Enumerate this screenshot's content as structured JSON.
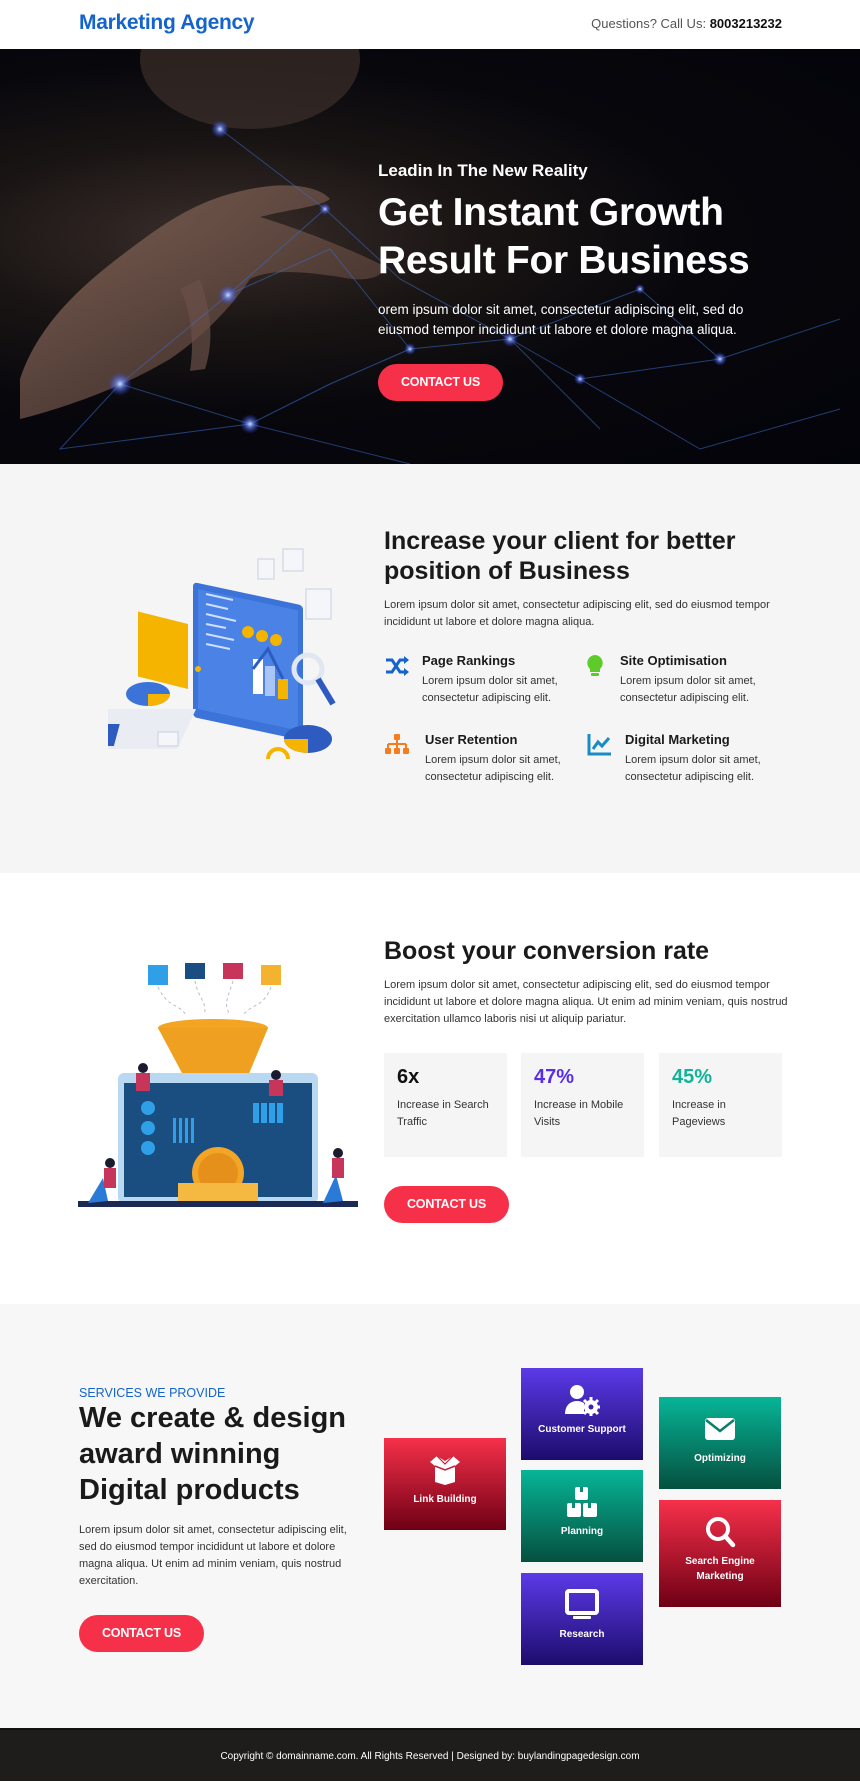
{
  "header": {
    "logo": "Marketing Agency",
    "call_label": "Questions? Call Us:",
    "phone": "8003213232"
  },
  "hero": {
    "subtitle": "Leadin In The New Reality",
    "title": "Get Instant Growth Result For Business",
    "text": "orem ipsum dolor sit amet, consectetur adipiscing elit, sed do eiusmod tempor incididunt ut labore et dolore magna aliqua.",
    "cta": "CONTACT US"
  },
  "features_section": {
    "title": "Increase your client for better position of Business",
    "lead": "Lorem ipsum dolor sit amet, consectetur adipiscing elit, sed do eiusmod tempor incididunt ut labore et dolore magna aliqua.",
    "items": [
      {
        "icon": "shuffle-icon",
        "title": "Page Rankings",
        "text": "Lorem ipsum dolor sit amet, consectetur adipiscing elit.",
        "color": "#1464cc"
      },
      {
        "icon": "lightbulb-icon",
        "title": "Site Optimisation",
        "text": "Lorem ipsum dolor sit amet, consectetur adipiscing elit.",
        "color": "#5ecb2a"
      },
      {
        "icon": "sitemap-icon",
        "title": "User Retention",
        "text": "Lorem ipsum dolor sit amet, consectetur adipiscing elit.",
        "color": "#f57c1f"
      },
      {
        "icon": "line-chart-icon",
        "title": "Digital Marketing",
        "text": "Lorem ipsum dolor sit amet, consectetur adipiscing elit.",
        "color": "#1a8ac8"
      }
    ]
  },
  "conversion_section": {
    "title": "Boost your conversion rate",
    "lead": "Lorem ipsum dolor sit amet, consectetur adipiscing elit, sed do eiusmod tempor incididunt ut labore et dolore magna aliqua. Ut enim ad minim veniam, quis nostrud exercitation ullamco laboris nisi ut aliquip pariatur.",
    "stats": [
      {
        "value": "6x",
        "label": "Increase in Search Traffic",
        "color": "#111111"
      },
      {
        "value": "47%",
        "label": "Increase in Mobile Visits",
        "color": "#5a2de6"
      },
      {
        "value": "45%",
        "label": "Increase in Pageviews",
        "color": "#12b39a"
      }
    ],
    "cta": "CONTACT US"
  },
  "services_section": {
    "eyebrow": "SERVICES WE PROVIDE",
    "title": "We create & design award winning Digital products",
    "lead": "Lorem ipsum dolor sit amet, consectetur adipiscing elit, sed do eiusmod tempor incididunt ut labore et dolore magna aliqua. Ut enim ad minim veniam, quis nostrud exercitation.",
    "cta": "CONTACT US",
    "tiles": [
      {
        "icon": "open-box-icon",
        "label": "Link Building"
      },
      {
        "icon": "user-gear-icon",
        "label": "Customer Support"
      },
      {
        "icon": "boxes-icon",
        "label": "Planning"
      },
      {
        "icon": "monitor-icon",
        "label": "Research"
      },
      {
        "icon": "envelope-icon",
        "label": "Optimizing"
      },
      {
        "icon": "search-icon",
        "label": "Search Engine Marketing"
      }
    ]
  },
  "footer": {
    "text": "Copyright © domainname.com. All Rights Reserved | Designed by: buylandingpagedesign.com"
  },
  "colors": {
    "brand": "#1464cc",
    "cta": "#f7304a",
    "footer_bg": "#1f1d1b"
  }
}
